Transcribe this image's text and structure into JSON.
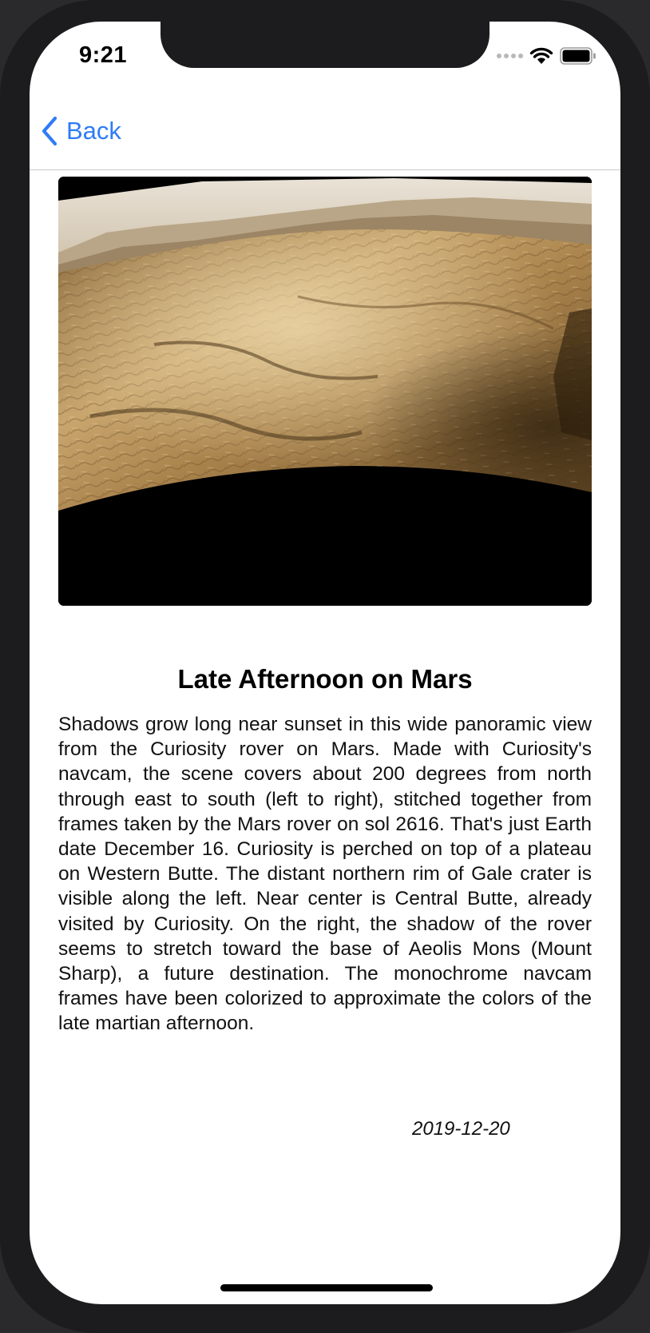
{
  "status_bar": {
    "time": "9:21",
    "icons": [
      "cellular-signal-icon",
      "wifi-icon",
      "battery-icon"
    ]
  },
  "nav": {
    "back_label": "Back",
    "accent_color": "#2f7cf6"
  },
  "article": {
    "title": "Late Afternoon on Mars",
    "description": "Shadows grow long near sunset in this wide panoramic view from the Curiosity rover on Mars. Made with Curiosity's navcam, the scene covers about 200 degrees from north through east to south (left to right), stitched together from frames taken by the Mars rover on sol 2616. That's just Earth date December 16. Curiosity is perched on top of a plateau on Western Butte. The distant northern rim of Gale crater is visible along the left. Near center is Central Butte, already visited by Curiosity. On the right, the shadow of the rover seems to stretch toward the base of Aeolis Mons (Mount Sharp), a future destination. The monochrome navcam frames have been colorized to approximate the colors of the late martian afternoon.",
    "date": "2019-12-20"
  }
}
